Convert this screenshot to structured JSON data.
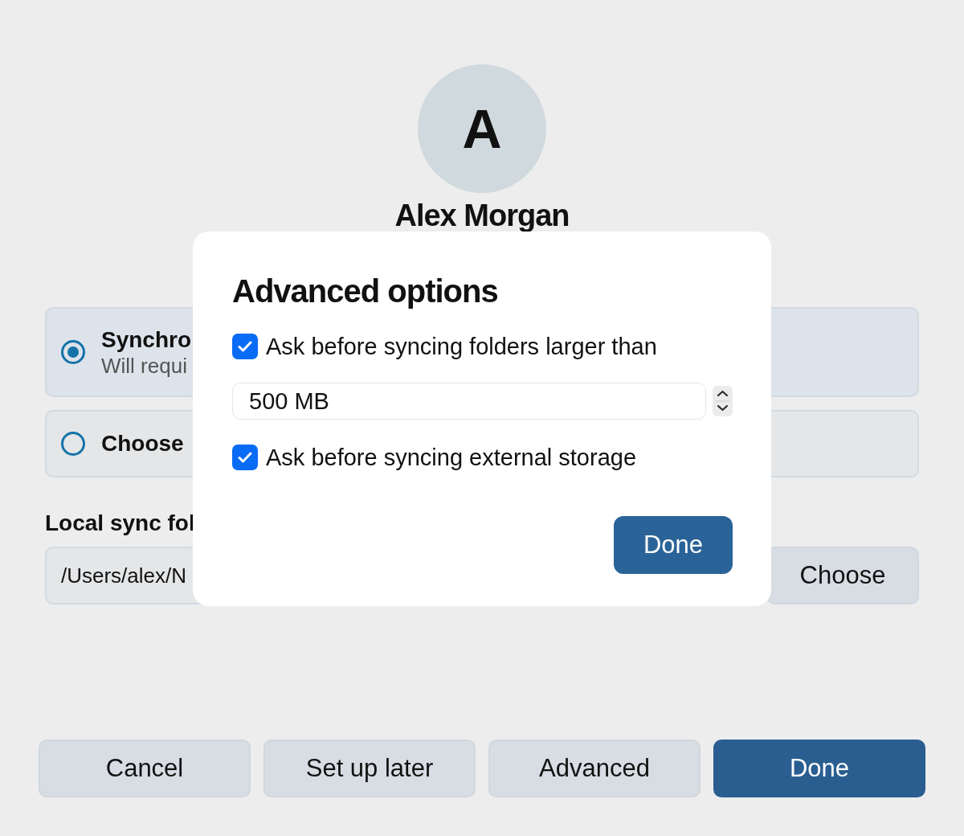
{
  "avatar": {
    "initial": "A"
  },
  "user_name": "Alex Morgan",
  "sync_options": [
    {
      "title": "Synchro",
      "subtitle": "Will requi",
      "selected": true
    },
    {
      "title": "Choose",
      "selected": false
    }
  ],
  "local_folder": {
    "label": "Local sync fol",
    "path": "/Users/alex/N",
    "choose_button": "Choose"
  },
  "buttons": [
    {
      "label": "Cancel",
      "kind": "secondary"
    },
    {
      "label": "Set up later",
      "kind": "secondary"
    },
    {
      "label": "Advanced",
      "kind": "secondary"
    },
    {
      "label": "Done",
      "kind": "primary"
    }
  ],
  "dialog": {
    "title": "Advanced options",
    "options": [
      {
        "kind": "checkbox",
        "label": "Ask before syncing folders larger than",
        "checked": true
      },
      {
        "kind": "number",
        "value": "500 MB"
      },
      {
        "kind": "checkbox",
        "label": "Ask before syncing external storage",
        "checked": true
      }
    ],
    "button": "Done"
  }
}
